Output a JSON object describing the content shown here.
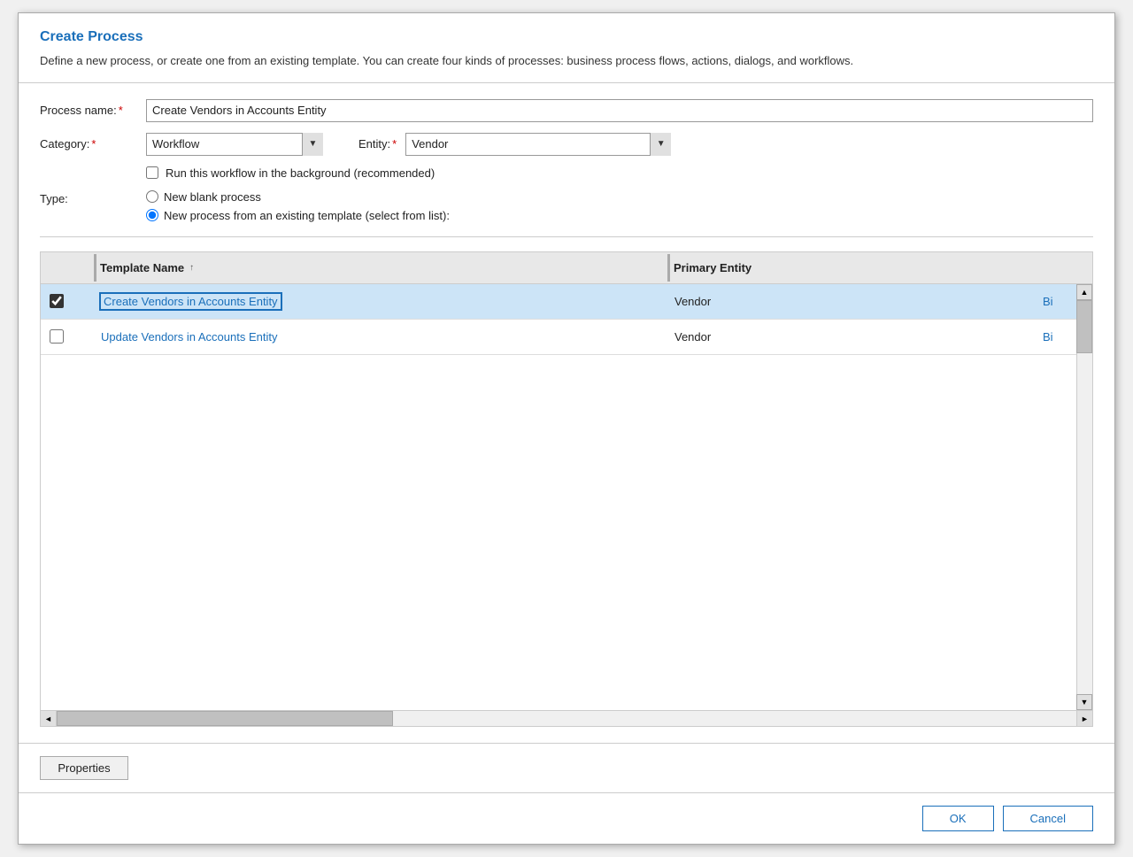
{
  "dialog": {
    "title": "Create Process",
    "description": "Define a new process, or create one from an existing template. You can create four kinds of processes: business process flows, actions, dialogs, and workflows."
  },
  "form": {
    "process_name_label": "Process name:",
    "process_name_value": "Create Vendors in Accounts Entity",
    "category_label": "Category:",
    "category_value": "Workflow",
    "entity_label": "Entity:",
    "entity_value": "Vendor",
    "required_star": "*",
    "background_checkbox_label": "Run this workflow in the background (recommended)",
    "background_checked": false,
    "type_label": "Type:",
    "type_options": [
      {
        "label": "New blank process",
        "value": "blank",
        "selected": false
      },
      {
        "label": "New process from an existing template (select from list):",
        "value": "template",
        "selected": true
      }
    ]
  },
  "table": {
    "columns": [
      {
        "key": "checkbox",
        "label": ""
      },
      {
        "key": "name",
        "label": "Template Name",
        "sortable": true,
        "sort_dir": "asc"
      },
      {
        "key": "entity",
        "label": "Primary Entity"
      }
    ],
    "rows": [
      {
        "id": 1,
        "checked": true,
        "selected": true,
        "name": "Create Vendors in Accounts Entity",
        "entity": "Vendor",
        "extra": "Bi"
      },
      {
        "id": 2,
        "checked": false,
        "selected": false,
        "name": "Update Vendors in Accounts Entity",
        "entity": "Vendor",
        "extra": "Bi"
      }
    ]
  },
  "bottom": {
    "properties_label": "Properties"
  },
  "footer": {
    "ok_label": "OK",
    "cancel_label": "Cancel"
  }
}
